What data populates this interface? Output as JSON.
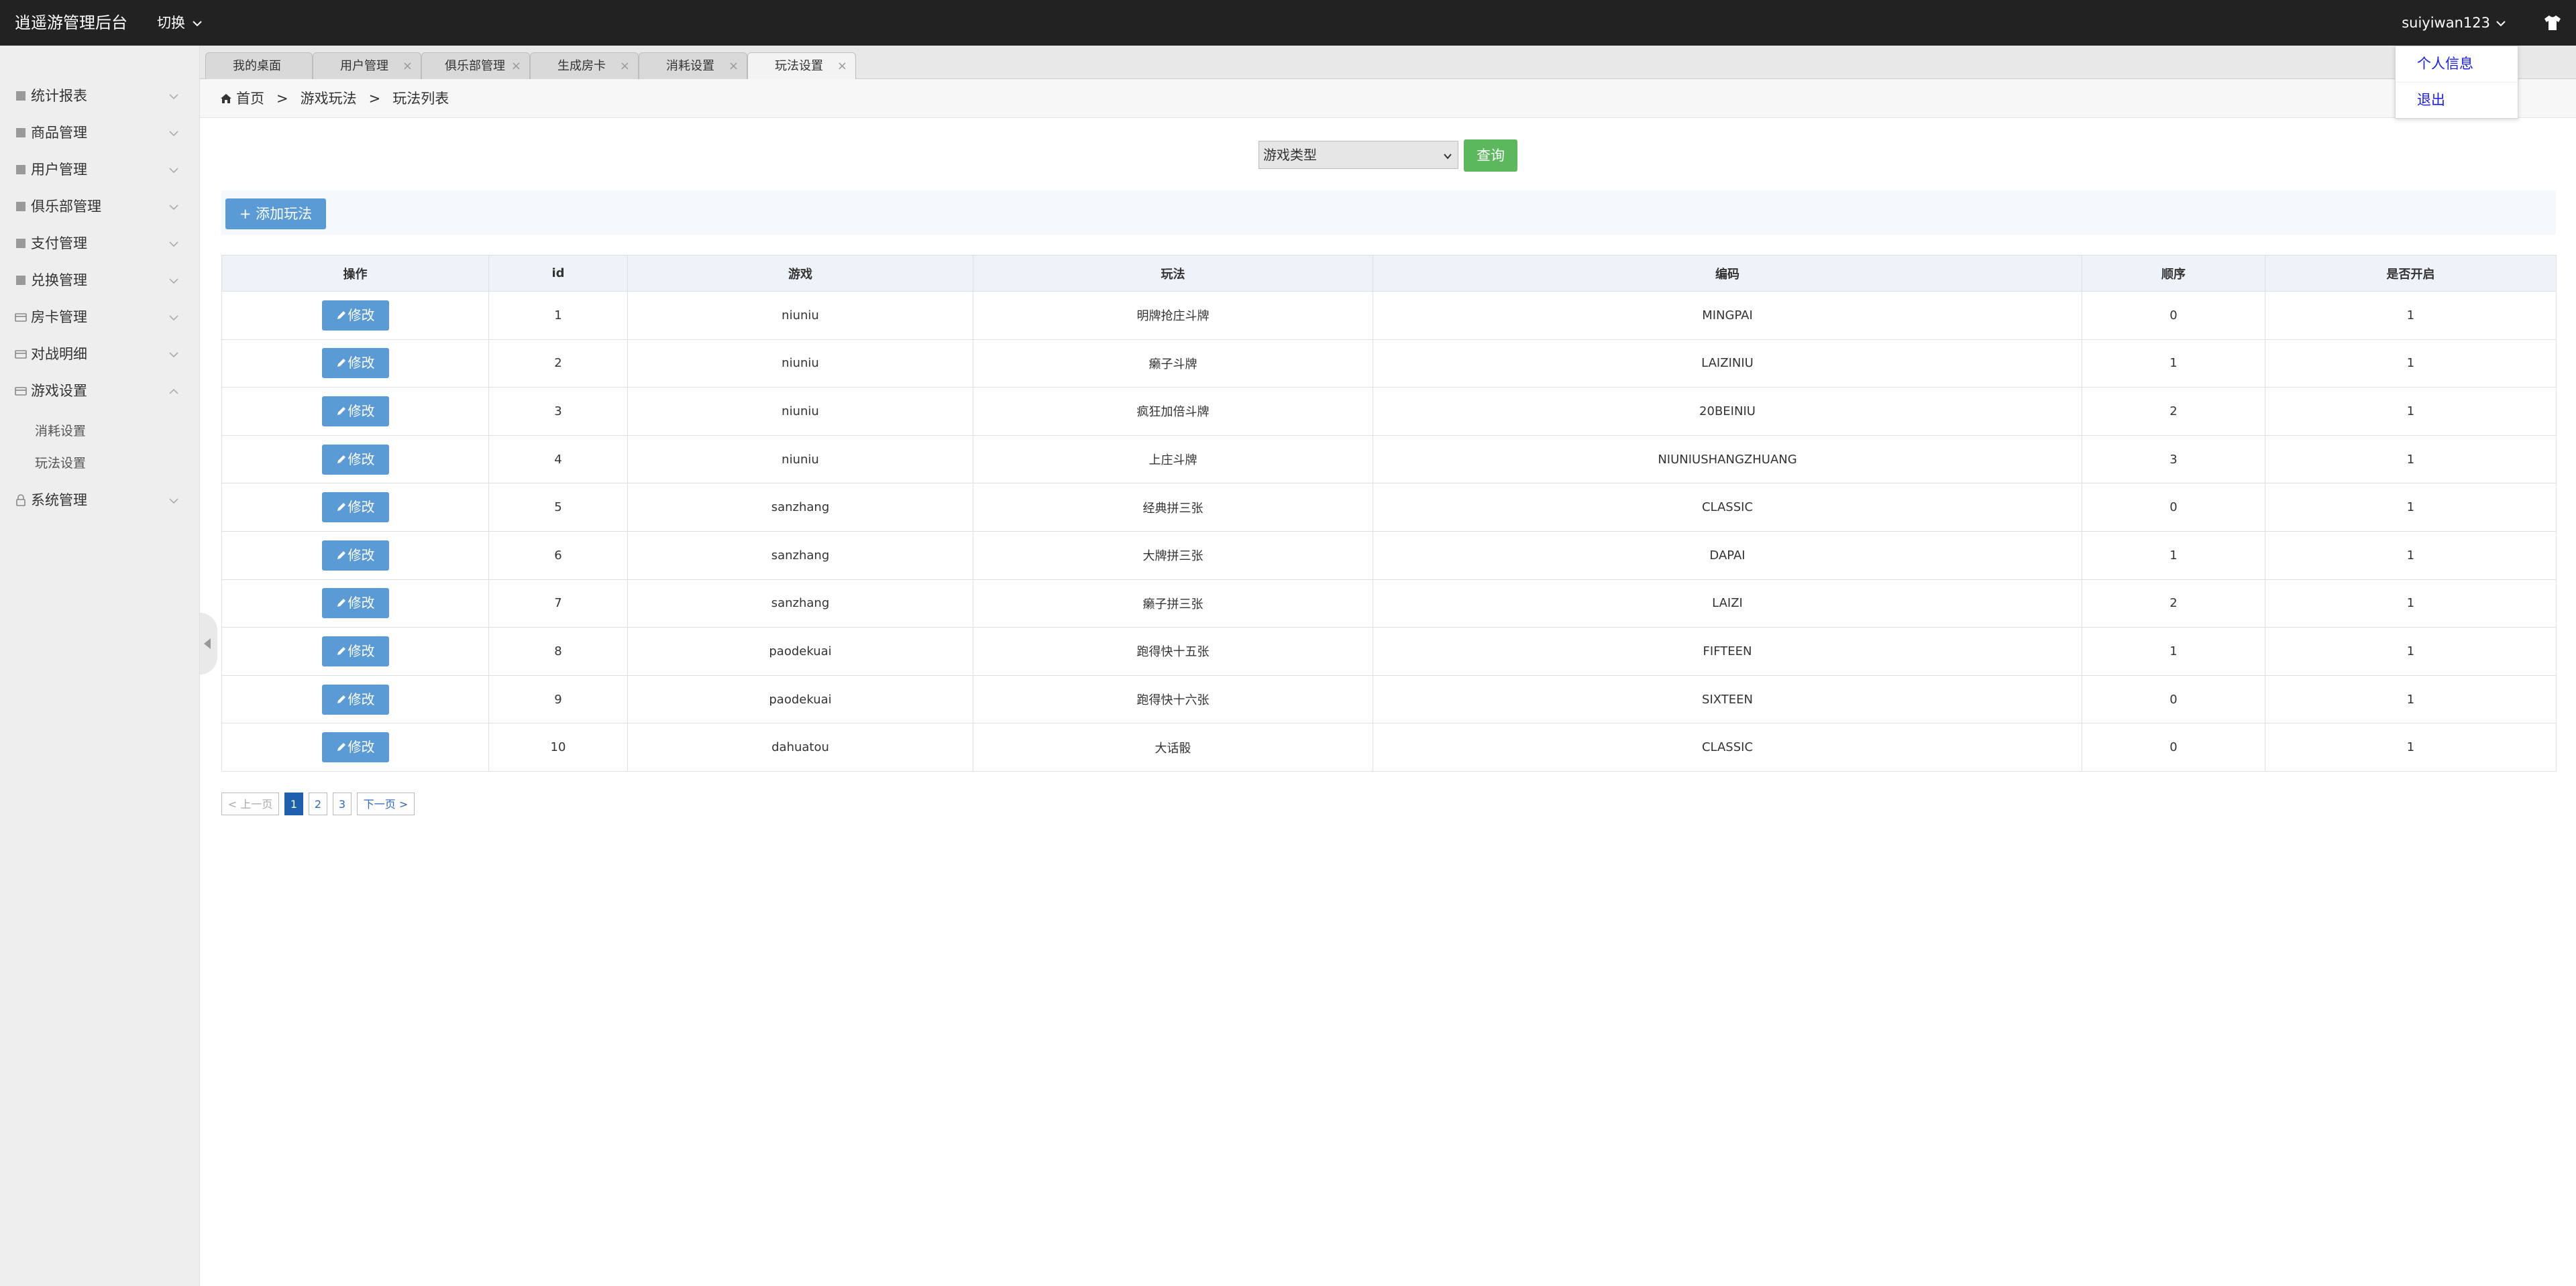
{
  "header": {
    "brand": "逍遥游管理后台",
    "switch_label": "切换",
    "username": "suiyiwan123",
    "user_menu": [
      "个人信息",
      "退出"
    ]
  },
  "sidebar": {
    "items": [
      {
        "label": "统计报表",
        "icon": "chart-icon"
      },
      {
        "label": "商品管理",
        "icon": "box-icon"
      },
      {
        "label": "用户管理",
        "icon": "user-icon"
      },
      {
        "label": "俱乐部管理",
        "icon": "club-icon"
      },
      {
        "label": "支付管理",
        "icon": "pay-icon"
      },
      {
        "label": "兑换管理",
        "icon": "exchange-icon"
      },
      {
        "label": "房卡管理",
        "icon": "card-icon"
      },
      {
        "label": "对战明细",
        "icon": "card-icon"
      },
      {
        "label": "游戏设置",
        "icon": "card-icon",
        "expanded": true,
        "children": [
          "消耗设置",
          "玩法设置"
        ]
      },
      {
        "label": "系统管理",
        "icon": "lock-icon"
      }
    ]
  },
  "tabs": [
    "我的桌面",
    "用户管理",
    "俱乐部管理",
    "生成房卡",
    "消耗设置",
    "玩法设置"
  ],
  "breadcrumb": {
    "home": "首页",
    "level1": "游戏玩法",
    "level2": "玩法列表"
  },
  "filter": {
    "select_value": "游戏类型",
    "query_label": "查询"
  },
  "toolbar": {
    "add_label": "添加玩法"
  },
  "table": {
    "columns": [
      "操作",
      "id",
      "游戏",
      "玩法",
      "编码",
      "顺序",
      "是否开启"
    ],
    "edit_label": "修改",
    "rows": [
      {
        "id": "1",
        "game": "niuniu",
        "play": "明牌抢庄斗牌",
        "code": "MINGPAI",
        "order": "0",
        "enabled": "1"
      },
      {
        "id": "2",
        "game": "niuniu",
        "play": "癞子斗牌",
        "code": "LAIZINIU",
        "order": "1",
        "enabled": "1"
      },
      {
        "id": "3",
        "game": "niuniu",
        "play": "疯狂加倍斗牌",
        "code": "20BEINIU",
        "order": "2",
        "enabled": "1"
      },
      {
        "id": "4",
        "game": "niuniu",
        "play": "上庄斗牌",
        "code": "NIUNIUSHANGZHUANG",
        "order": "3",
        "enabled": "1"
      },
      {
        "id": "5",
        "game": "sanzhang",
        "play": "经典拼三张",
        "code": "CLASSIC",
        "order": "0",
        "enabled": "1"
      },
      {
        "id": "6",
        "game": "sanzhang",
        "play": "大牌拼三张",
        "code": "DAPAI",
        "order": "1",
        "enabled": "1"
      },
      {
        "id": "7",
        "game": "sanzhang",
        "play": "癞子拼三张",
        "code": "LAIZI",
        "order": "2",
        "enabled": "1"
      },
      {
        "id": "8",
        "game": "paodekuai",
        "play": "跑得快十五张",
        "code": "FIFTEEN",
        "order": "1",
        "enabled": "1"
      },
      {
        "id": "9",
        "game": "paodekuai",
        "play": "跑得快十六张",
        "code": "SIXTEEN",
        "order": "0",
        "enabled": "1"
      },
      {
        "id": "10",
        "game": "dahuatou",
        "play": "大话骰",
        "code": "CLASSIC",
        "order": "0",
        "enabled": "1"
      }
    ]
  },
  "pagination": {
    "prev": "< 上一页",
    "pages": [
      "1",
      "2",
      "3"
    ],
    "current": "1",
    "next": "下一页 >"
  }
}
